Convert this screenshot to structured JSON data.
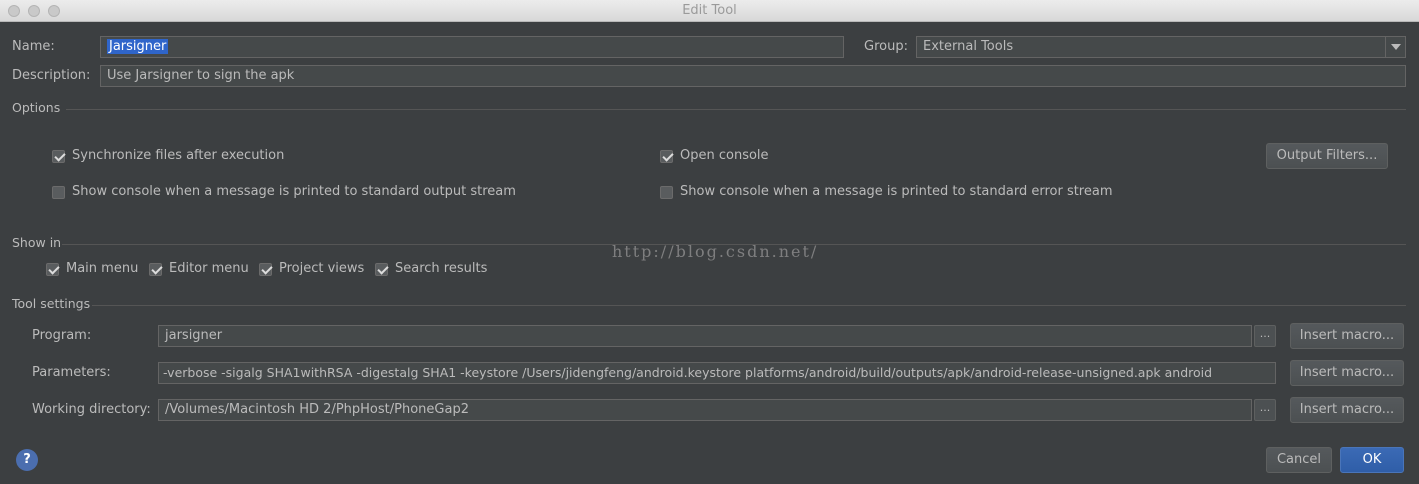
{
  "window": {
    "title": "Edit Tool"
  },
  "name": {
    "label": "Name:",
    "value": "Jarsigner"
  },
  "group": {
    "label": "Group:",
    "value": "External Tools"
  },
  "description": {
    "label": "Description:",
    "value": "Use Jarsigner to sign the apk"
  },
  "options": {
    "title": "Options",
    "sync_files": {
      "label": "Synchronize files after execution",
      "checked": true
    },
    "open_console": {
      "label": "Open console",
      "checked": true
    },
    "output_filters_label": "Output Filters...",
    "console_stdout": {
      "label": "Show console when a message is printed to standard output stream",
      "checked": false
    },
    "console_stderr": {
      "label": "Show console when a message is printed to standard error stream",
      "checked": false
    }
  },
  "show_in": {
    "title": "Show in",
    "items": [
      {
        "label": "Main menu",
        "checked": true
      },
      {
        "label": "Editor menu",
        "checked": true
      },
      {
        "label": "Project views",
        "checked": true
      },
      {
        "label": "Search results",
        "checked": true
      }
    ]
  },
  "tool_settings": {
    "title": "Tool settings",
    "program": {
      "label": "Program:",
      "value": "jarsigner"
    },
    "parameters": {
      "label": "Parameters:",
      "value": "-verbose -sigalg SHA1withRSA -digestalg SHA1 -keystore /Users/jidengfeng/android.keystore platforms/android/build/outputs/apk/android-release-unsigned.apk android"
    },
    "working_directory": {
      "label": "Working directory:",
      "value": "/Volumes/Macintosh HD 2/PhpHost/PhoneGap2"
    },
    "insert_macro_label": "Insert macro...",
    "browse_label": "..."
  },
  "watermark": "http://blog.csdn.net/",
  "footer": {
    "help_label": "?",
    "cancel_label": "Cancel",
    "ok_label": "OK"
  },
  "colors": {
    "background": "#3c3f41",
    "accent": "#2f65ca",
    "ok_button": "#365f9f",
    "text": "#bbbbbb"
  }
}
